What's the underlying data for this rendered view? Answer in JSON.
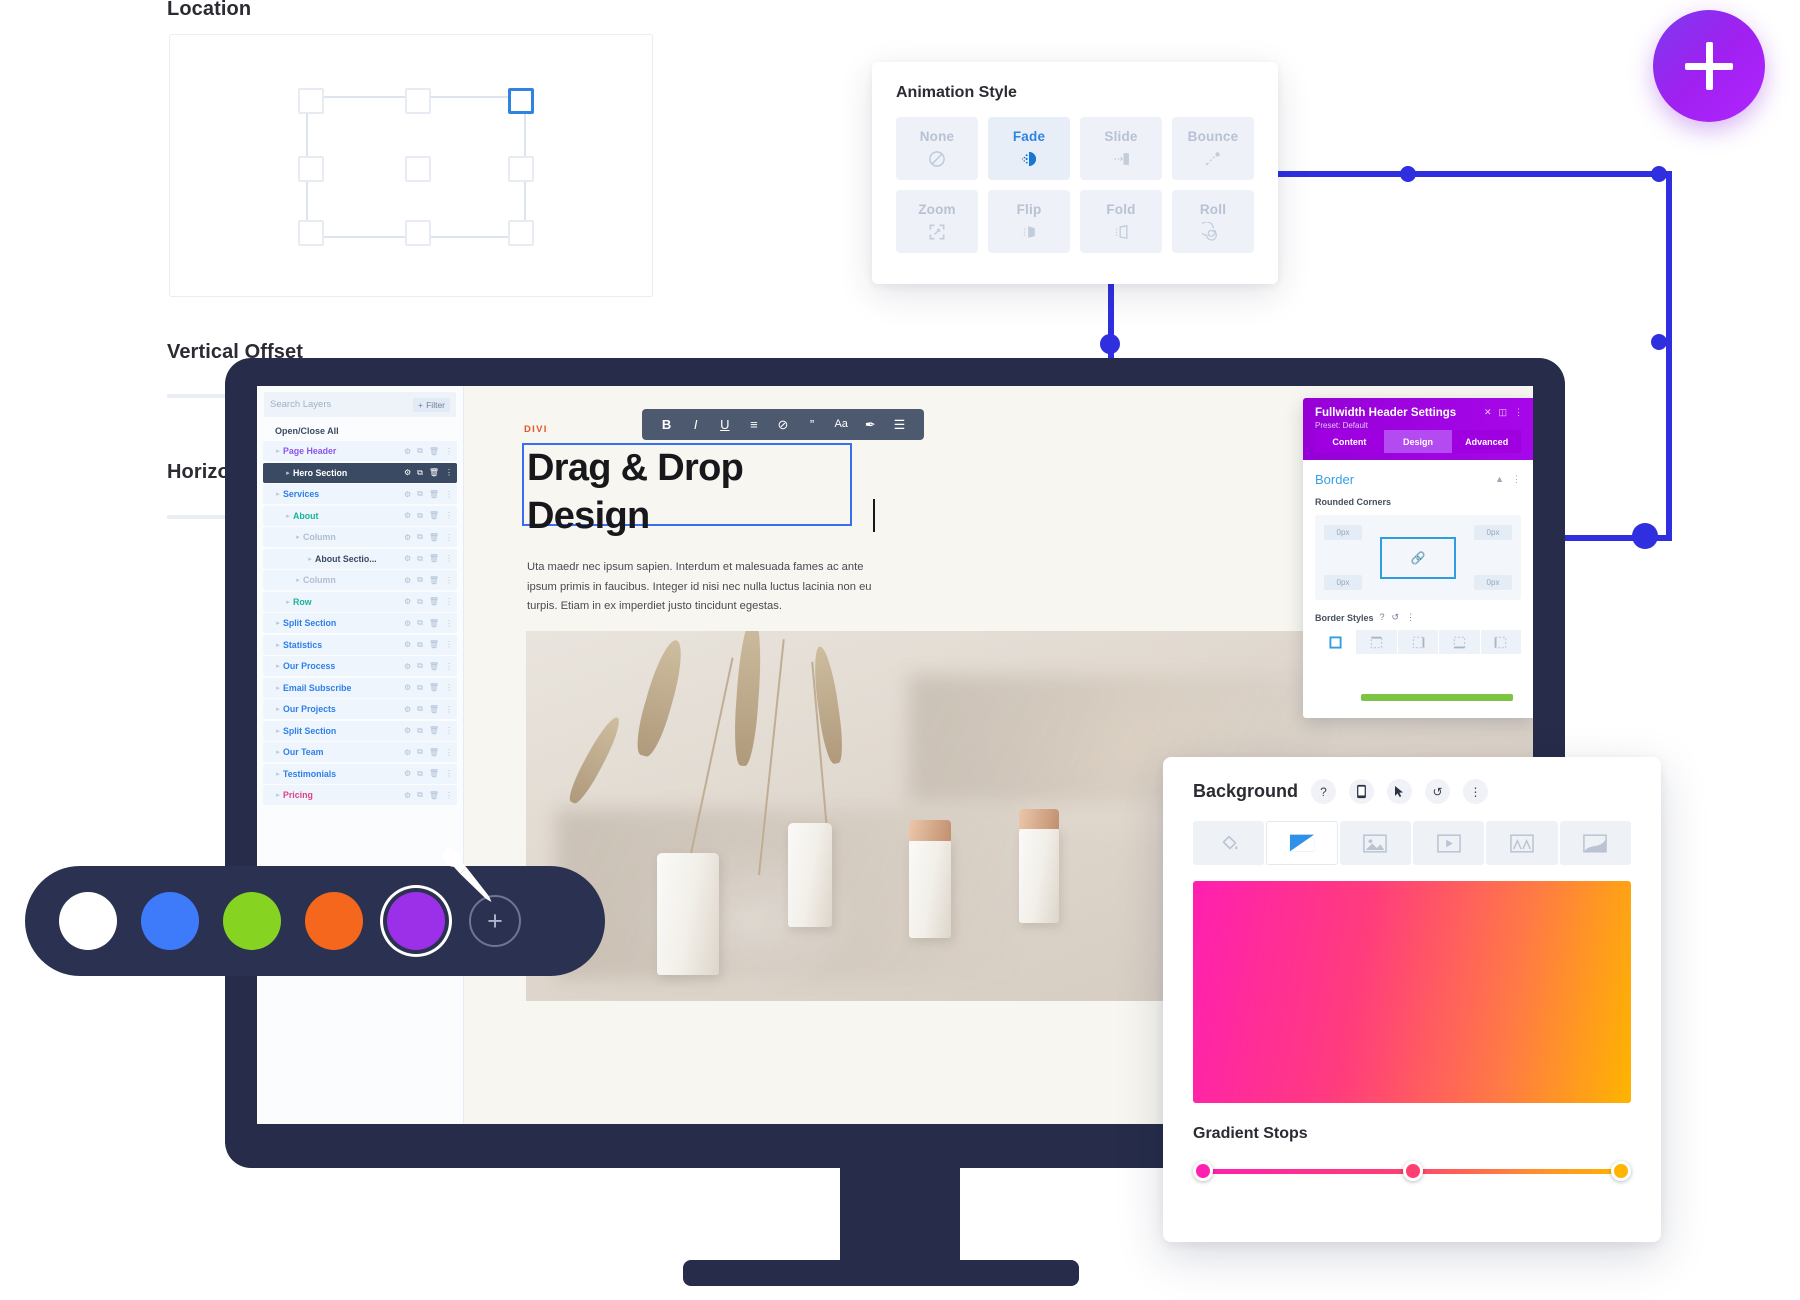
{
  "background_ui": {
    "location_label": "Location",
    "vertical_offset_label": "Vertical Offset",
    "horizontal_offset_label": "Horizontal Offset",
    "selected_handle": "top-right"
  },
  "animation_panel": {
    "title": "Animation Style",
    "selected": "Fade",
    "options": [
      {
        "label": "None",
        "icon": "no-entry-icon"
      },
      {
        "label": "Fade",
        "icon": "fade-icon"
      },
      {
        "label": "Slide",
        "icon": "slide-icon"
      },
      {
        "label": "Bounce",
        "icon": "bounce-icon"
      },
      {
        "label": "Zoom",
        "icon": "zoom-expand-icon"
      },
      {
        "label": "Flip",
        "icon": "flip-icon"
      },
      {
        "label": "Fold",
        "icon": "fold-icon"
      },
      {
        "label": "Roll",
        "icon": "roll-spiral-icon"
      }
    ]
  },
  "plus_badge": {
    "icon": "plus-icon"
  },
  "layers_panel": {
    "search_placeholder": "Search Layers",
    "filter_label": "Filter",
    "open_close_label": "Open/Close All",
    "items": [
      {
        "name": "Page Header",
        "indent": 0,
        "color": "purple",
        "selected": false
      },
      {
        "name": "Hero Section",
        "indent": 1,
        "color": "dark",
        "selected": true
      },
      {
        "name": "Services",
        "indent": 0,
        "color": "blue",
        "selected": false
      },
      {
        "name": "About",
        "indent": 1,
        "color": "teal",
        "selected": false
      },
      {
        "name": "Column",
        "indent": 2,
        "color": "grey",
        "selected": false
      },
      {
        "name": "About Sectio...",
        "indent": 3,
        "color": "dark",
        "selected": false
      },
      {
        "name": "Column",
        "indent": 2,
        "color": "grey",
        "selected": false
      },
      {
        "name": "Row",
        "indent": 1,
        "color": "teal",
        "selected": false
      },
      {
        "name": "Split Section",
        "indent": 0,
        "color": "blue",
        "selected": false
      },
      {
        "name": "Statistics",
        "indent": 0,
        "color": "blue",
        "selected": false
      },
      {
        "name": "Our Process",
        "indent": 0,
        "color": "blue",
        "selected": false
      },
      {
        "name": "Email Subscribe",
        "indent": 0,
        "color": "blue",
        "selected": false
      },
      {
        "name": "Our Projects",
        "indent": 0,
        "color": "blue",
        "selected": false
      },
      {
        "name": "Split Section",
        "indent": 0,
        "color": "blue",
        "selected": false
      },
      {
        "name": "Our Team",
        "indent": 0,
        "color": "blue",
        "selected": false
      },
      {
        "name": "Testimonials",
        "indent": 0,
        "color": "blue",
        "selected": false
      },
      {
        "name": "Pricing",
        "indent": 0,
        "color": "pink",
        "selected": false
      }
    ]
  },
  "canvas": {
    "brand_tag": "DIVI",
    "toolbar": [
      {
        "icon": "bold-icon",
        "glyph": "B"
      },
      {
        "icon": "italic-icon",
        "glyph": "I"
      },
      {
        "icon": "underline-icon",
        "glyph": "U"
      },
      {
        "icon": "align-icon",
        "glyph": "≡"
      },
      {
        "icon": "unlink-icon",
        "glyph": "⊘"
      },
      {
        "icon": "quote-icon",
        "glyph": "”"
      },
      {
        "icon": "font-size-icon",
        "glyph": "Aa"
      },
      {
        "icon": "text-color-icon",
        "glyph": "✒"
      },
      {
        "icon": "list-icon",
        "glyph": "☰"
      }
    ],
    "heading": "Drag & Drop Design",
    "body": "Uta maedr nec ipsum sapien. Interdum et malesuada fames ac ante ipsum primis in faucibus. Integer id nisi nec nulla luctus lacinia non eu turpis. Etiam in ex imperdiet justo tincidunt egestas."
  },
  "divi_settings": {
    "title": "Fullwidth Header Settings",
    "preset": "Preset: Default",
    "header_icons": [
      "close-icon",
      "layout-toggle-icon",
      "more-vertical-icon"
    ],
    "tabs": [
      {
        "label": "Content",
        "active": false
      },
      {
        "label": "Design",
        "active": true
      },
      {
        "label": "Advanced",
        "active": false
      }
    ],
    "section_title": "Border",
    "section_icons": [
      "chevron-up-icon",
      "more-vertical-icon"
    ],
    "rounded_corners_label": "Rounded Corners",
    "corner_values": [
      "0px",
      "0px",
      "0px",
      "0px"
    ],
    "corner_link_icon": "link-icon",
    "border_styles_label": "Border Styles",
    "border_styles_icons": [
      "help-icon",
      "reset-icon",
      "more-vertical-icon"
    ],
    "border_style_buttons": [
      {
        "icon": "border-all-icon",
        "active": true
      },
      {
        "icon": "border-top-icon",
        "active": false
      },
      {
        "icon": "border-right-icon",
        "active": false
      },
      {
        "icon": "border-bottom-icon",
        "active": false
      },
      {
        "icon": "border-left-icon",
        "active": false
      }
    ]
  },
  "background_panel": {
    "title": "Background",
    "header_icons": [
      "help-icon",
      "mobile-icon",
      "cursor-icon",
      "reset-icon",
      "more-vertical-icon"
    ],
    "tabs": [
      {
        "icon": "paint-bucket-icon",
        "active": false
      },
      {
        "icon": "gradient-icon",
        "active": true
      },
      {
        "icon": "image-icon",
        "active": false
      },
      {
        "icon": "video-icon",
        "active": false
      },
      {
        "icon": "pattern-icon",
        "active": false
      },
      {
        "icon": "mask-icon",
        "active": false
      }
    ],
    "gradient_stops_label": "Gradient Stops",
    "gradient_colors": [
      "#ff1fb0",
      "#ff3f72",
      "#ffb400"
    ],
    "gradient_stop_positions": [
      0,
      48,
      100
    ]
  },
  "color_picker": {
    "swatches": [
      {
        "color": "#ffffff",
        "active": false
      },
      {
        "color": "#3e7bfa",
        "active": false
      },
      {
        "color": "#86d321",
        "active": false
      },
      {
        "color": "#f4671c",
        "active": false
      },
      {
        "color": "#9b30e8",
        "active": true
      }
    ],
    "add_label": "+",
    "eyedropper_icon": "eyedropper-icon"
  },
  "accent_colors": {
    "connector_blue": "#2f2fe0",
    "divi_purple": "#9600d6",
    "divi_orange": "#e2572b",
    "selection_blue": "#3a6ef0"
  }
}
